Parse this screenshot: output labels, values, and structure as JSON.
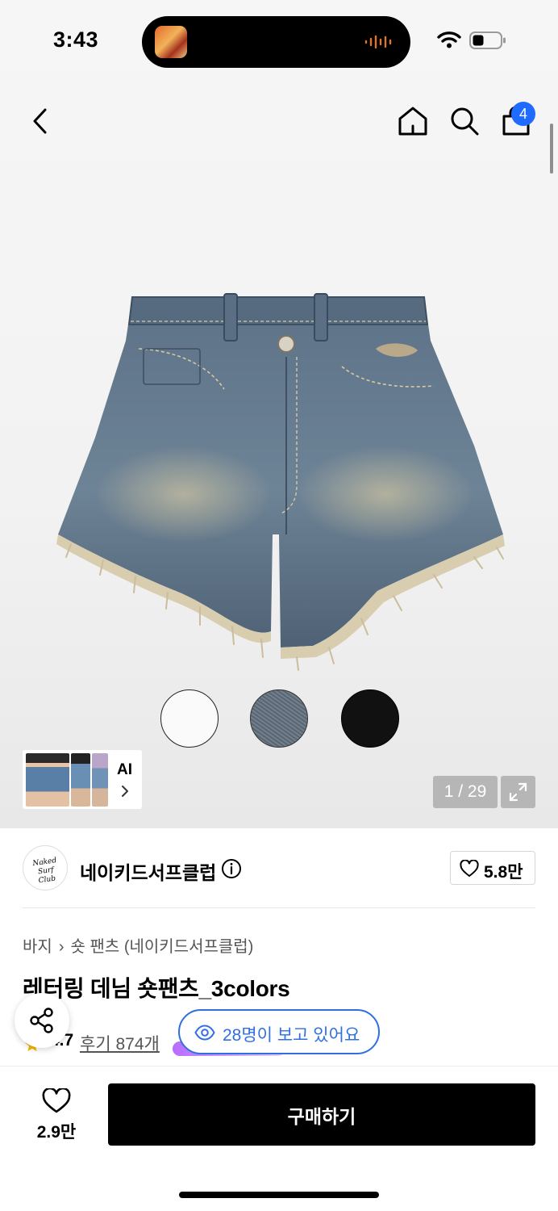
{
  "status_bar": {
    "time": "3:43"
  },
  "nav": {
    "cart_count": "4"
  },
  "gallery": {
    "counter": "1 / 29",
    "ai_label": "AI",
    "swatches": [
      "white",
      "denim",
      "black"
    ]
  },
  "brand": {
    "logo_text": "Naked Surf Club",
    "name": "네이키드서프클럽",
    "likes": "5.8만"
  },
  "breadcrumb": {
    "category": "바지",
    "subcategory": "숏 팬츠",
    "brand_tag": "(네이키드서프클럽)"
  },
  "product": {
    "title": "레터링 데님 숏팬츠_3colors",
    "rating": "4.7",
    "reviews_label": "후기 874개"
  },
  "viewers": {
    "text": "28명이 보고 있어요"
  },
  "bottom_bar": {
    "wish_count": "2.9만",
    "buy_label": "구매하기"
  },
  "colors": {
    "accent_blue": "#2f6fe0",
    "badge_blue": "#1f6bff",
    "buy_button": "#000000"
  },
  "icons": [
    "back-icon",
    "home-icon",
    "search-icon",
    "cart-icon",
    "expand-icon",
    "info-icon",
    "heart-icon",
    "share-icon",
    "eye-icon",
    "star-icon",
    "chevron-right-icon"
  ]
}
